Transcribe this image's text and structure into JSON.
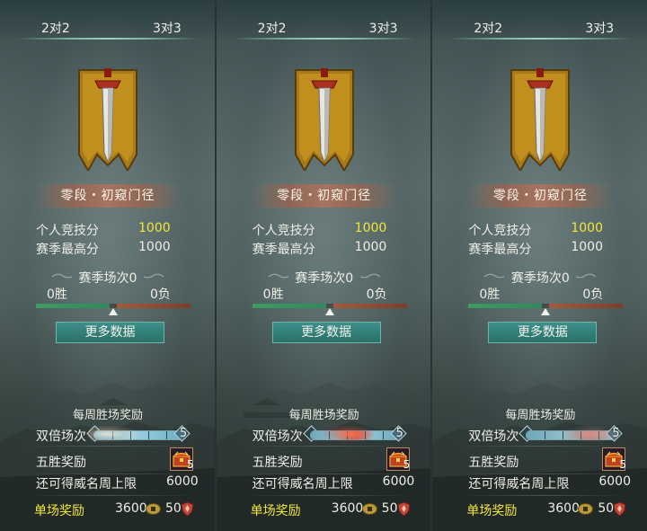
{
  "panels": [
    {
      "tabs": {
        "left": "2对2",
        "right": "3对3"
      },
      "rank_name": "零段・初窥门径",
      "personal_score_label": "个人竞技分",
      "personal_score_value": "1000",
      "season_high_label": "赛季最高分",
      "season_high_value": "1000",
      "season_matches": "赛季场次0",
      "wins": "0胜",
      "losses": "0负",
      "win_fraction": 0.5,
      "more_data_button": "更多数据",
      "weekly_reward_title": "每周胜场奖励",
      "double_matches_label": "双倍场次",
      "double_matches_count": "5",
      "five_win_label": "五胜奖励",
      "five_win_count": "5",
      "prestige_cap_label": "还可得威名周上限",
      "prestige_cap_value": "6000",
      "single_reward_label": "单场奖励",
      "single_reward_coins": "3600",
      "single_reward_shields": "50"
    },
    {
      "tabs": {
        "left": "2对2",
        "right": "3对3"
      },
      "rank_name": "零段・初窥门径",
      "personal_score_label": "个人竞技分",
      "personal_score_value": "1000",
      "season_high_label": "赛季最高分",
      "season_high_value": "1000",
      "season_matches": "赛季场次0",
      "wins": "0胜",
      "losses": "0负",
      "win_fraction": 0.5,
      "more_data_button": "更多数据",
      "weekly_reward_title": "每周胜场奖励",
      "double_matches_label": "双倍场次",
      "double_matches_count": "5",
      "five_win_label": "五胜奖励",
      "five_win_count": "5",
      "prestige_cap_label": "还可得威名周上限",
      "prestige_cap_value": "6000",
      "single_reward_label": "单场奖励",
      "single_reward_coins": "3600",
      "single_reward_shields": "50"
    },
    {
      "tabs": {
        "left": "2对2",
        "right": "3对3"
      },
      "rank_name": "零段・初窥门径",
      "personal_score_label": "个人竞技分",
      "personal_score_value": "1000",
      "season_high_label": "赛季最高分",
      "season_high_value": "1000",
      "season_matches": "赛季场次0",
      "wins": "0胜",
      "losses": "0负",
      "win_fraction": 0.5,
      "more_data_button": "更多数据",
      "weekly_reward_title": "每周胜场奖励",
      "double_matches_label": "双倍场次",
      "double_matches_count": "5",
      "five_win_label": "五胜奖励",
      "five_win_count": "5",
      "prestige_cap_label": "还可得威名周上限",
      "prestige_cap_value": "6000",
      "single_reward_label": "单场奖励",
      "single_reward_coins": "3600",
      "single_reward_shields": "50"
    }
  ],
  "colors": {
    "highlight_yellow": "#f3e63a",
    "win_green": "#3f9a66",
    "loss_red": "#a45a3a",
    "button_teal": "#2f7d76"
  },
  "icons": {
    "rank_emblem": "sword-banner-icon",
    "chest": "treasure-chest-icon",
    "coin": "coin-icon",
    "shield": "shield-icon"
  }
}
